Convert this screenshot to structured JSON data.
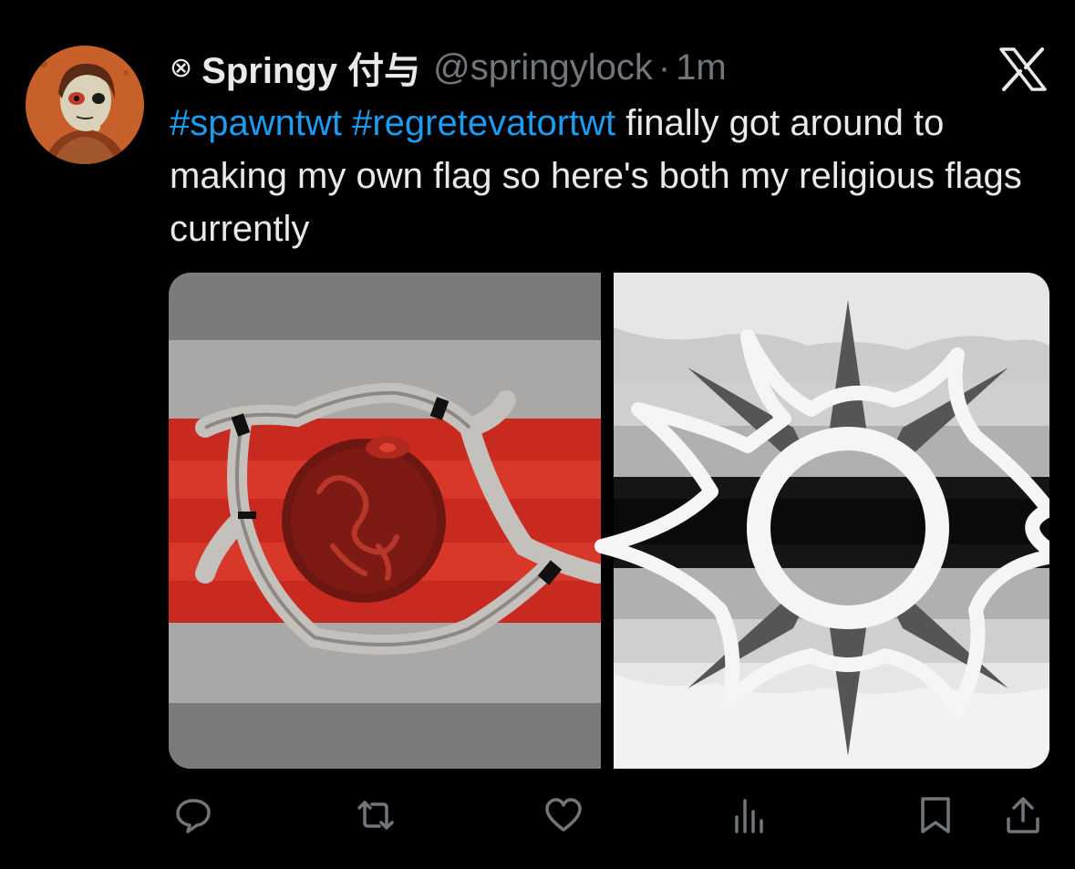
{
  "tweet": {
    "author_badge_icon": "pentagram-circle-icon",
    "display_name": "Springy 付与",
    "handle": "@springylock",
    "separator": "·",
    "timestamp": "1m",
    "hashtags": [
      "#spawntwt",
      "#regretevatortwt"
    ],
    "body": "finally got around to making my own flag so here's both my religious flags currently"
  },
  "media": {
    "images": [
      {
        "icon": "red-orb-bone-ring-flag"
      },
      {
        "icon": "white-spiked-sun-flag"
      }
    ]
  },
  "actions": {
    "items": [
      {
        "icon": "reply-icon"
      },
      {
        "icon": "retweet-icon"
      },
      {
        "icon": "like-icon"
      },
      {
        "icon": "views-icon"
      },
      {
        "icon": "bookmark-icon"
      },
      {
        "icon": "share-icon"
      }
    ]
  },
  "colors": {
    "background": "#000000",
    "text": "#e7e9ea",
    "muted": "#71767b",
    "link": "#1d9bf0"
  }
}
